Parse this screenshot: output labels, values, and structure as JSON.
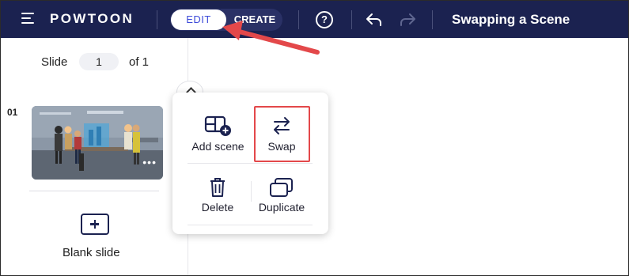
{
  "topbar": {
    "logo": "POWTOON",
    "mode_edit": "EDIT",
    "mode_create": "CREATE",
    "title": "Swapping a Scene",
    "icons": [
      "menu-icon",
      "help-icon",
      "undo-icon",
      "redo-icon"
    ]
  },
  "sidebar": {
    "slide_label": "Slide",
    "current_slide": "1",
    "of_total": "of 1",
    "slide_number": "01",
    "blank_slide_label": "Blank slide"
  },
  "popup": {
    "add_scene": "Add scene",
    "swap": "Swap",
    "delete": "Delete",
    "duplicate": "Duplicate"
  },
  "colors": {
    "topbar_bg": "#1b2250",
    "edit_text": "#3d4bd9",
    "highlight": "#e3484a"
  }
}
